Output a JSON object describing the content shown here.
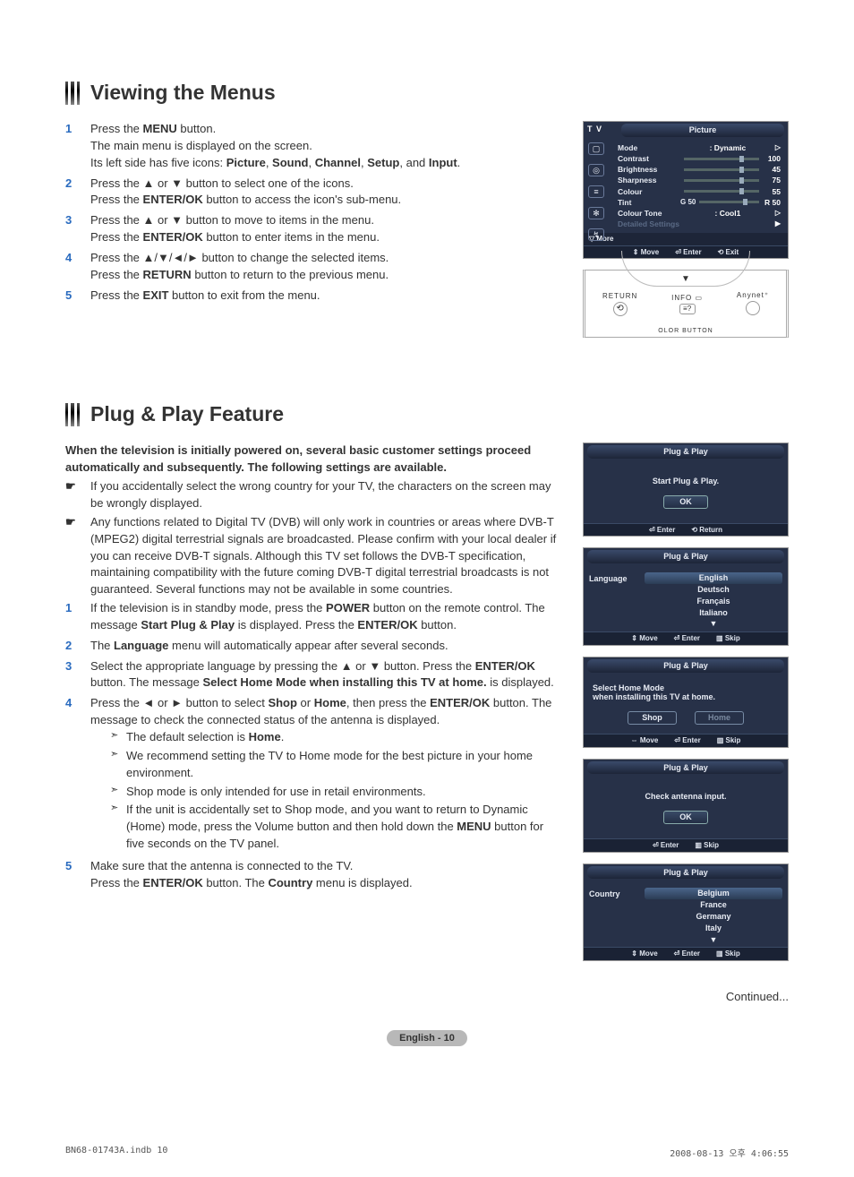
{
  "sections": {
    "viewing": {
      "title": "Viewing the Menus",
      "steps": [
        {
          "num": "1",
          "lines": [
            [
              {
                "t": "Press the "
              },
              {
                "t": "MENU",
                "b": true
              },
              {
                "t": " button."
              }
            ],
            [
              {
                "t": "The main menu is displayed on the screen."
              }
            ],
            [
              {
                "t": "Its left side has five icons: "
              },
              {
                "t": "Picture",
                "b": true
              },
              {
                "t": ", "
              },
              {
                "t": "Sound",
                "b": true
              },
              {
                "t": ", "
              },
              {
                "t": "Channel",
                "b": true
              },
              {
                "t": ", "
              },
              {
                "t": "Setup",
                "b": true
              },
              {
                "t": ", and "
              },
              {
                "t": "Input",
                "b": true
              },
              {
                "t": "."
              }
            ]
          ]
        },
        {
          "num": "2",
          "lines": [
            [
              {
                "t": "Press the ▲ or ▼ button to select one of the icons."
              }
            ],
            [
              {
                "t": "Press the "
              },
              {
                "t": "ENTER/OK",
                "b": true
              },
              {
                "t": " button to access the icon's sub-menu."
              }
            ]
          ]
        },
        {
          "num": "3",
          "lines": [
            [
              {
                "t": "Press the ▲ or ▼ button to move to items in the menu."
              }
            ],
            [
              {
                "t": "Press the "
              },
              {
                "t": "ENTER/OK",
                "b": true
              },
              {
                "t": " button to enter items in the menu."
              }
            ]
          ]
        },
        {
          "num": "4",
          "lines": [
            [
              {
                "t": "Press the ▲/▼/◄/► button to change the selected items."
              }
            ],
            [
              {
                "t": "Press the "
              },
              {
                "t": "RETURN",
                "b": true
              },
              {
                "t": " button to return to the previous menu."
              }
            ]
          ]
        },
        {
          "num": "5",
          "lines": [
            [
              {
                "t": "Press the "
              },
              {
                "t": "EXIT",
                "b": true
              },
              {
                "t": " button to exit from the menu."
              }
            ]
          ]
        }
      ]
    },
    "plugplay": {
      "title": "Plug & Play Feature",
      "intro": "When the television is initially powered on, several basic customer settings proceed automatically and subsequently. The following settings are available.",
      "notes": [
        "If you accidentally select the wrong country for your TV, the characters on the screen may be wrongly displayed.",
        "Any functions related to Digital TV (DVB) will only work in countries or areas where DVB-T (MPEG2) digital terrestrial signals are broadcasted. Please confirm with your local dealer if you can receive DVB-T signals. Although this TV set follows the DVB-T specification, maintaining compatibility with the future coming DVB-T digital terrestrial broadcasts is not guaranteed. Several functions may not be available in some countries."
      ],
      "steps": [
        {
          "num": "1",
          "lines": [
            [
              {
                "t": "If the television is in standby mode, press the "
              },
              {
                "t": "POWER",
                "b": true
              },
              {
                "t": " button on the remote control. The message "
              },
              {
                "t": "Start Plug & Play",
                "b": true
              },
              {
                "t": " is displayed. Press the "
              },
              {
                "t": "ENTER/OK",
                "b": true
              },
              {
                "t": " button."
              }
            ]
          ]
        },
        {
          "num": "2",
          "lines": [
            [
              {
                "t": "The "
              },
              {
                "t": "Language",
                "b": true
              },
              {
                "t": " menu will automatically appear after several seconds."
              }
            ]
          ]
        },
        {
          "num": "3",
          "lines": [
            [
              {
                "t": "Select the appropriate language by pressing the ▲ or ▼ button. Press the "
              },
              {
                "t": "ENTER/OK",
                "b": true
              },
              {
                "t": " button. The message "
              },
              {
                "t": "Select Home Mode when installing this TV at home.",
                "b": true
              },
              {
                "t": " is displayed."
              }
            ]
          ]
        },
        {
          "num": "4",
          "lines": [
            [
              {
                "t": "Press the ◄ or ► button to select "
              },
              {
                "t": "Shop",
                "b": true
              },
              {
                "t": " or "
              },
              {
                "t": "Home",
                "b": true
              },
              {
                "t": ", then press the "
              },
              {
                "t": "ENTER/OK",
                "b": true
              },
              {
                "t": " button. The message to check the connected status of the antenna is displayed."
              }
            ]
          ],
          "bullets": [
            [
              {
                "t": "The default selection is "
              },
              {
                "t": "Home",
                "b": true
              },
              {
                "t": "."
              }
            ],
            [
              {
                "t": "We recommend setting the TV to Home mode for the best picture in your home environment."
              }
            ],
            [
              {
                "t": "Shop mode is only intended for use in retail environments."
              }
            ],
            [
              {
                "t": "If the unit is accidentally set to Shop mode, and you want to return to Dynamic (Home) mode, press the Volume button and then hold down the "
              },
              {
                "t": "MENU",
                "b": true
              },
              {
                "t": " button for five seconds on the TV panel."
              }
            ]
          ]
        },
        {
          "num": "5",
          "lines": [
            [
              {
                "t": "Make sure that the antenna is connected to the TV."
              }
            ],
            [
              {
                "t": "Press the "
              },
              {
                "t": "ENTER/OK",
                "b": true
              },
              {
                "t": " button. The "
              },
              {
                "t": "Country",
                "b": true
              },
              {
                "t": " menu is displayed."
              }
            ]
          ]
        }
      ]
    }
  },
  "osd_picture": {
    "tv": "T V",
    "tab": "Picture",
    "rows": [
      {
        "label": "Mode",
        "value": ": Dynamic",
        "type": "text"
      },
      {
        "label": "Contrast",
        "value": "100",
        "type": "slider"
      },
      {
        "label": "Brightness",
        "value": "45",
        "type": "slider"
      },
      {
        "label": "Sharpness",
        "value": "75",
        "type": "slider"
      },
      {
        "label": "Colour",
        "value": "55",
        "type": "slider"
      },
      {
        "label": "Tint",
        "prefix": "G  50",
        "value": "R  50",
        "type": "slider"
      },
      {
        "label": "Colour Tone",
        "value": ": Cool1",
        "type": "text"
      },
      {
        "label": "Detailed Settings",
        "type": "disabled"
      }
    ],
    "more": "▽  More",
    "footer": {
      "move": "Move",
      "enter": "Enter",
      "exit": "Exit"
    }
  },
  "remote": {
    "return": "RETURN",
    "info": "INFO",
    "anynet": "Anynet⁺",
    "bottom": "OLOR BUTTON"
  },
  "osd_start": {
    "tab": "Plug & Play",
    "msg": "Start Plug & Play.",
    "ok": "OK",
    "footer": {
      "enter": "Enter",
      "return": "Return"
    }
  },
  "osd_lang": {
    "tab": "Plug & Play",
    "label": "Language",
    "opts": [
      "English",
      "Deutsch",
      "Français",
      "Italiano"
    ],
    "selIndex": 0,
    "footer": {
      "move": "Move",
      "enter": "Enter",
      "skip": "Skip"
    }
  },
  "osd_mode": {
    "tab": "Plug & Play",
    "msg1": "Select Home Mode",
    "msg2": "when installing this TV at home.",
    "btn1": "Shop",
    "btn2": "Home",
    "footer": {
      "move": "Move",
      "enter": "Enter",
      "skip": "Skip"
    }
  },
  "osd_antenna": {
    "tab": "Plug & Play",
    "msg": "Check antenna input.",
    "ok": "OK",
    "footer": {
      "enter": "Enter",
      "skip": "Skip"
    }
  },
  "osd_country": {
    "tab": "Plug & Play",
    "label": "Country",
    "opts": [
      "Belgium",
      "France",
      "Germany",
      "Italy"
    ],
    "selIndex": 0,
    "footer": {
      "move": "Move",
      "enter": "Enter",
      "skip": "Skip"
    }
  },
  "continued": "Continued...",
  "page_label": "English - 10",
  "doc_footer": {
    "left": "BN68-01743A.indb   10",
    "right": "2008-08-13   오후 4:06:55"
  }
}
